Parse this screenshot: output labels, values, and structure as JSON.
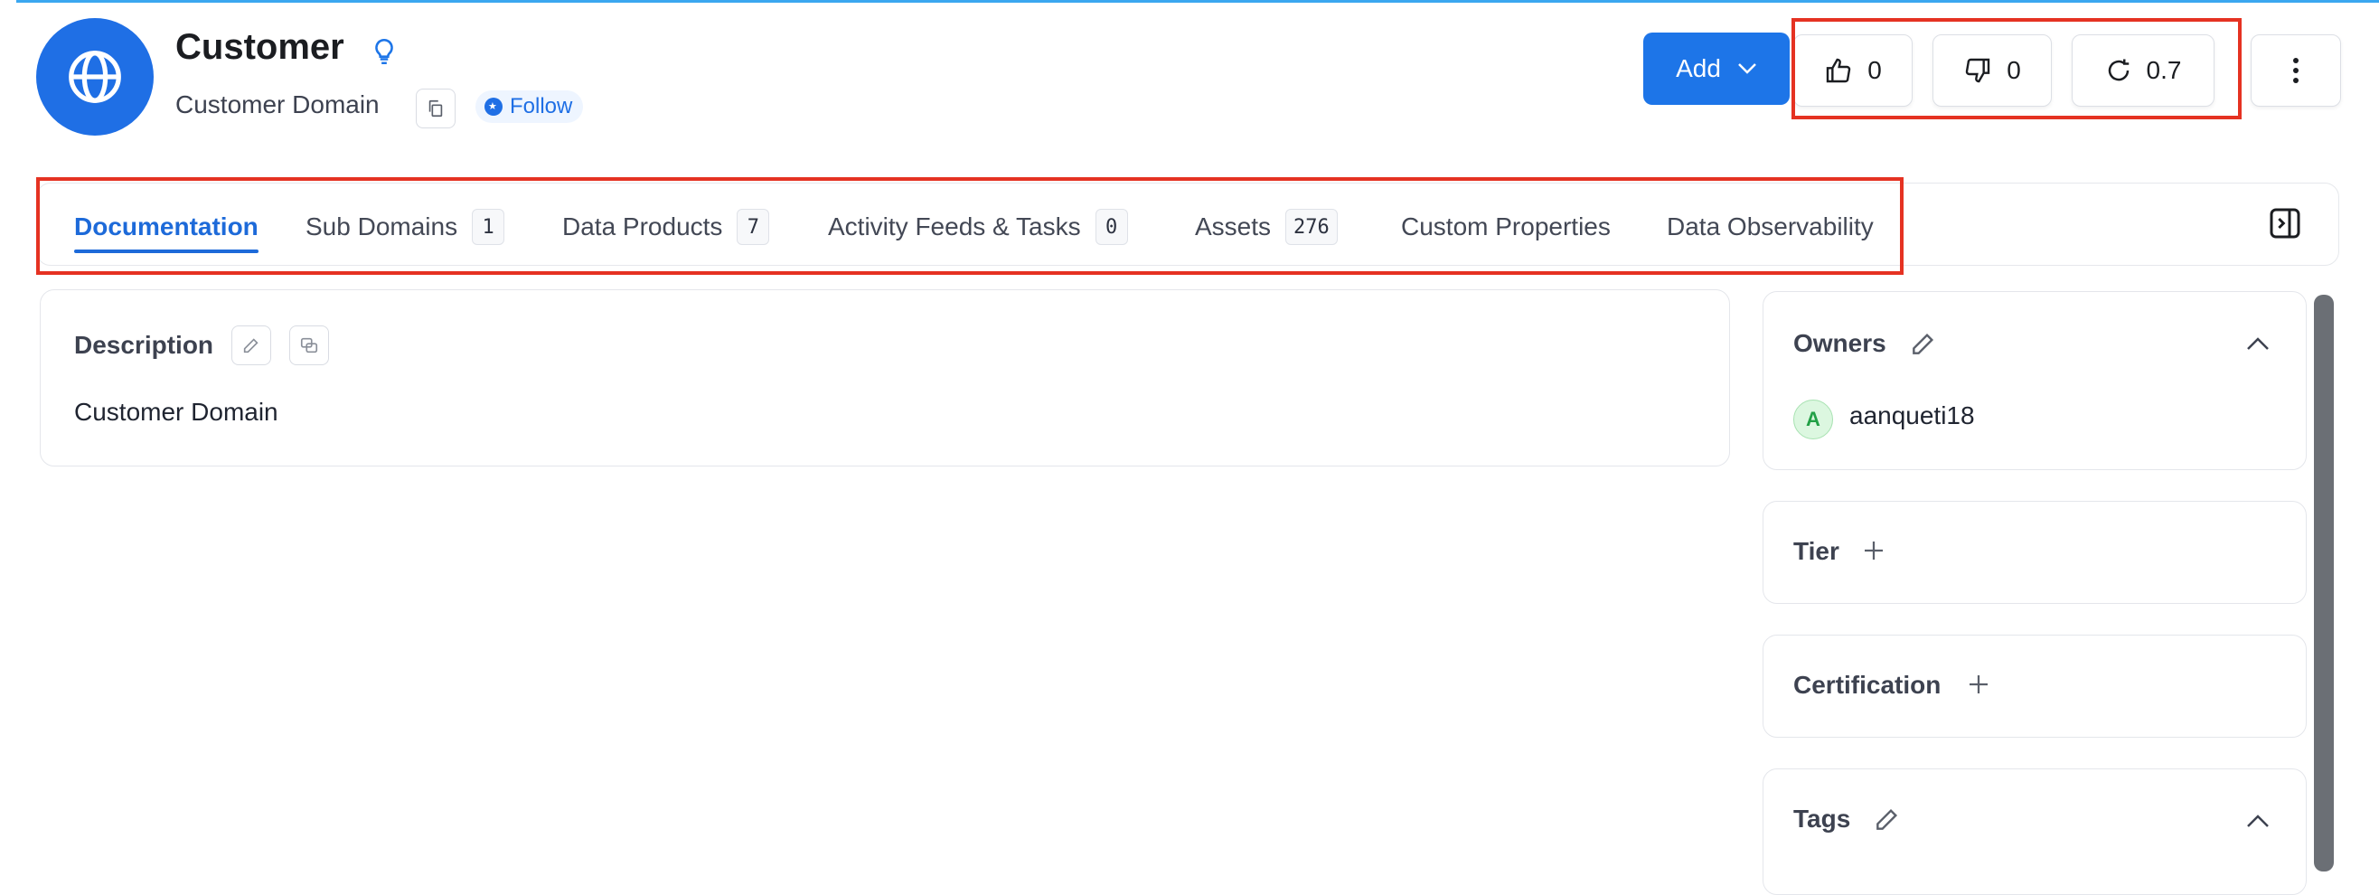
{
  "header": {
    "title": "Customer",
    "subtitle": "Customer Domain",
    "follow_label": "Follow",
    "icons": [
      "globe-icon",
      "lightbulb-icon",
      "copy-icon"
    ]
  },
  "actions": {
    "add_label": "Add",
    "upvote_count": "0",
    "downvote_count": "0",
    "version": "0.7",
    "icons": [
      "thumbs-up-icon",
      "thumbs-down-icon",
      "refresh-icon",
      "more-vertical-icon"
    ]
  },
  "tabs": [
    {
      "label": "Documentation",
      "count": null,
      "active": true
    },
    {
      "label": "Sub Domains",
      "count": "1"
    },
    {
      "label": "Data Products",
      "count": "7"
    },
    {
      "label": "Activity Feeds & Tasks",
      "count": "0"
    },
    {
      "label": "Assets",
      "count": "276"
    },
    {
      "label": "Custom Properties",
      "count": null
    },
    {
      "label": "Data Observability",
      "count": null
    }
  ],
  "description": {
    "label": "Description",
    "text": "Customer Domain"
  },
  "sidebar": {
    "owners_label": "Owners",
    "owner_initial": "A",
    "owner_name": "aanqueti18",
    "tier_label": "Tier",
    "certification_label": "Certification",
    "tags_label": "Tags"
  },
  "colors": {
    "accent": "#1d75e8",
    "highlight": "#e53222"
  }
}
